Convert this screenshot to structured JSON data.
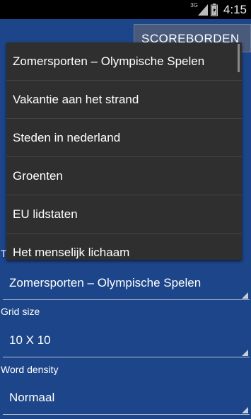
{
  "status_bar": {
    "network": "3G",
    "time": "4:15"
  },
  "header": {
    "scoreboard_button": "SCOREBORDEN"
  },
  "form": {
    "topic_label_partial": "T",
    "topic_value": "Zomersporten – Olympische Spelen",
    "grid_size_label": "Grid size",
    "grid_size_value": "10 X 10",
    "word_density_label": "Word density",
    "word_density_value": "Normaal"
  },
  "dropdown": {
    "items": [
      "Zomersporten – Olympische Spelen",
      "Vakantie aan het strand",
      "Steden in nederland",
      "Groenten",
      "EU lidstaten",
      "Het menselijk lichaam"
    ]
  },
  "colors": {
    "app_background": "#1d4589",
    "dropdown_background": "#2f2f2f",
    "status_bar": "#000000"
  }
}
